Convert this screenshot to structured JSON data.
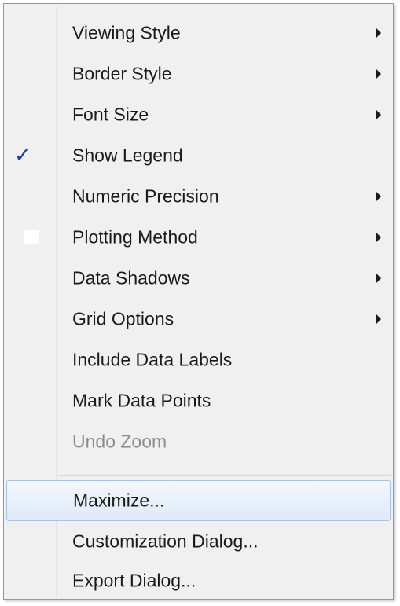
{
  "menu": {
    "items": [
      {
        "label": "Viewing Style",
        "submenu": true
      },
      {
        "label": "Border Style",
        "submenu": true
      },
      {
        "label": "Font Size",
        "submenu": true
      },
      {
        "label": "Show Legend",
        "checked": true
      },
      {
        "label": "Numeric Precision",
        "submenu": true
      },
      {
        "label": "Plotting Method",
        "submenu": true
      },
      {
        "label": "Data Shadows",
        "submenu": true
      },
      {
        "label": "Grid Options",
        "submenu": true
      },
      {
        "label": "Include Data Labels"
      },
      {
        "label": "Mark Data Points"
      },
      {
        "label": "Undo Zoom",
        "disabled": true
      },
      {
        "label": "Maximize...",
        "highlighted": true
      },
      {
        "label": "Customization Dialog..."
      },
      {
        "label": "Export Dialog..."
      }
    ],
    "check_glyph": "✓",
    "colors": {
      "background": "#f0f0f0",
      "check": "#1e3f9a",
      "highlight_border": "#a6c3e8",
      "disabled_text": "#8d8d8d"
    }
  }
}
